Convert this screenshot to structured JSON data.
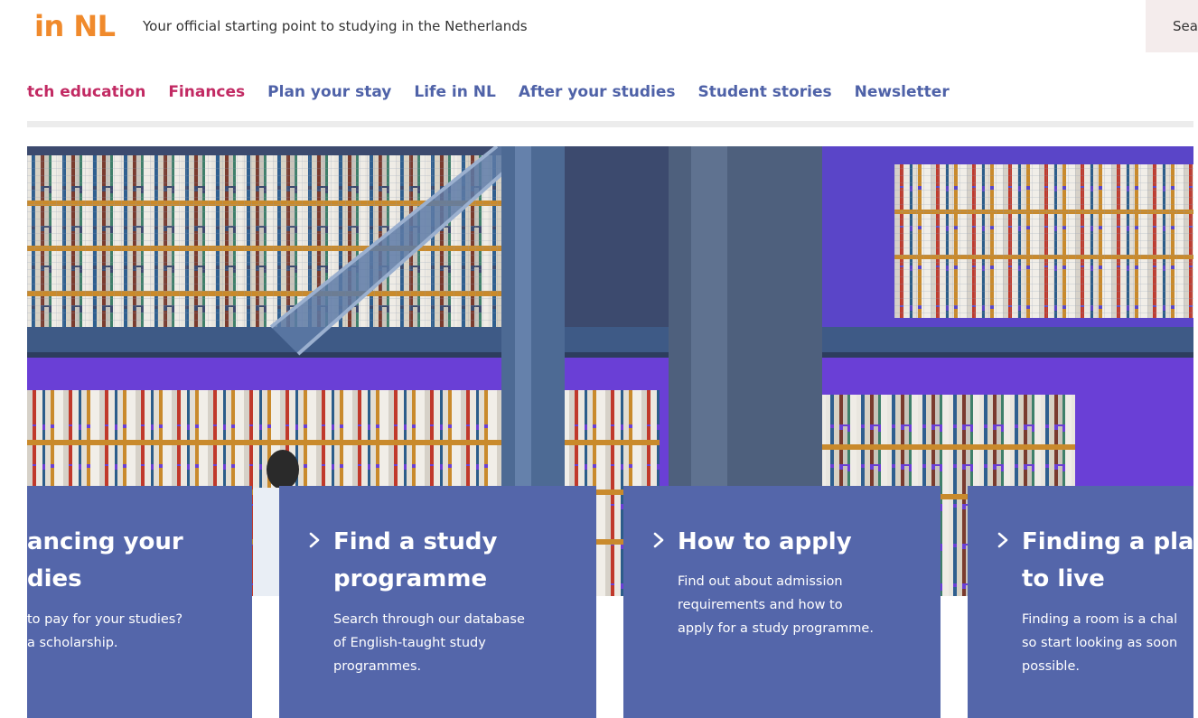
{
  "header": {
    "logo": "in NL",
    "tagline": "Your official starting point to studying in the Netherlands",
    "search_label": "Search"
  },
  "nav": {
    "items": [
      {
        "label": "tch education",
        "active": true
      },
      {
        "label": "Finances",
        "active": true
      },
      {
        "label": "Plan your stay",
        "active": false
      },
      {
        "label": "Life in NL",
        "active": false
      },
      {
        "label": "After your studies",
        "active": false
      },
      {
        "label": "Student stories",
        "active": false
      },
      {
        "label": "Newsletter",
        "active": false
      }
    ]
  },
  "colors": {
    "logo_orange": "#f08a2c",
    "nav_pink": "#c22a63",
    "nav_blue": "#4f62a8",
    "card_blue": "#5466aa"
  },
  "cards": [
    {
      "title_line1": "ancing your",
      "title_line2": "dies",
      "text_line1": "to pay for your studies?",
      "text_line2": "a scholarship.",
      "text_line3": ""
    },
    {
      "title_line1": "Find a study",
      "title_line2": "programme",
      "text_line1": "Search through our database",
      "text_line2": "of English-taught study",
      "text_line3": "programmes."
    },
    {
      "title_line1": "How to apply",
      "title_line2": "",
      "text_line1": "Find out about admission",
      "text_line2": "requirements and how to",
      "text_line3": "apply for a study programme."
    },
    {
      "title_line1": "Finding a plac",
      "title_line2": "to live",
      "text_line1": "Finding a room is a chal",
      "text_line2": "so start looking as soon",
      "text_line3": "possible."
    }
  ],
  "hero": {
    "icon": "library-photo"
  }
}
